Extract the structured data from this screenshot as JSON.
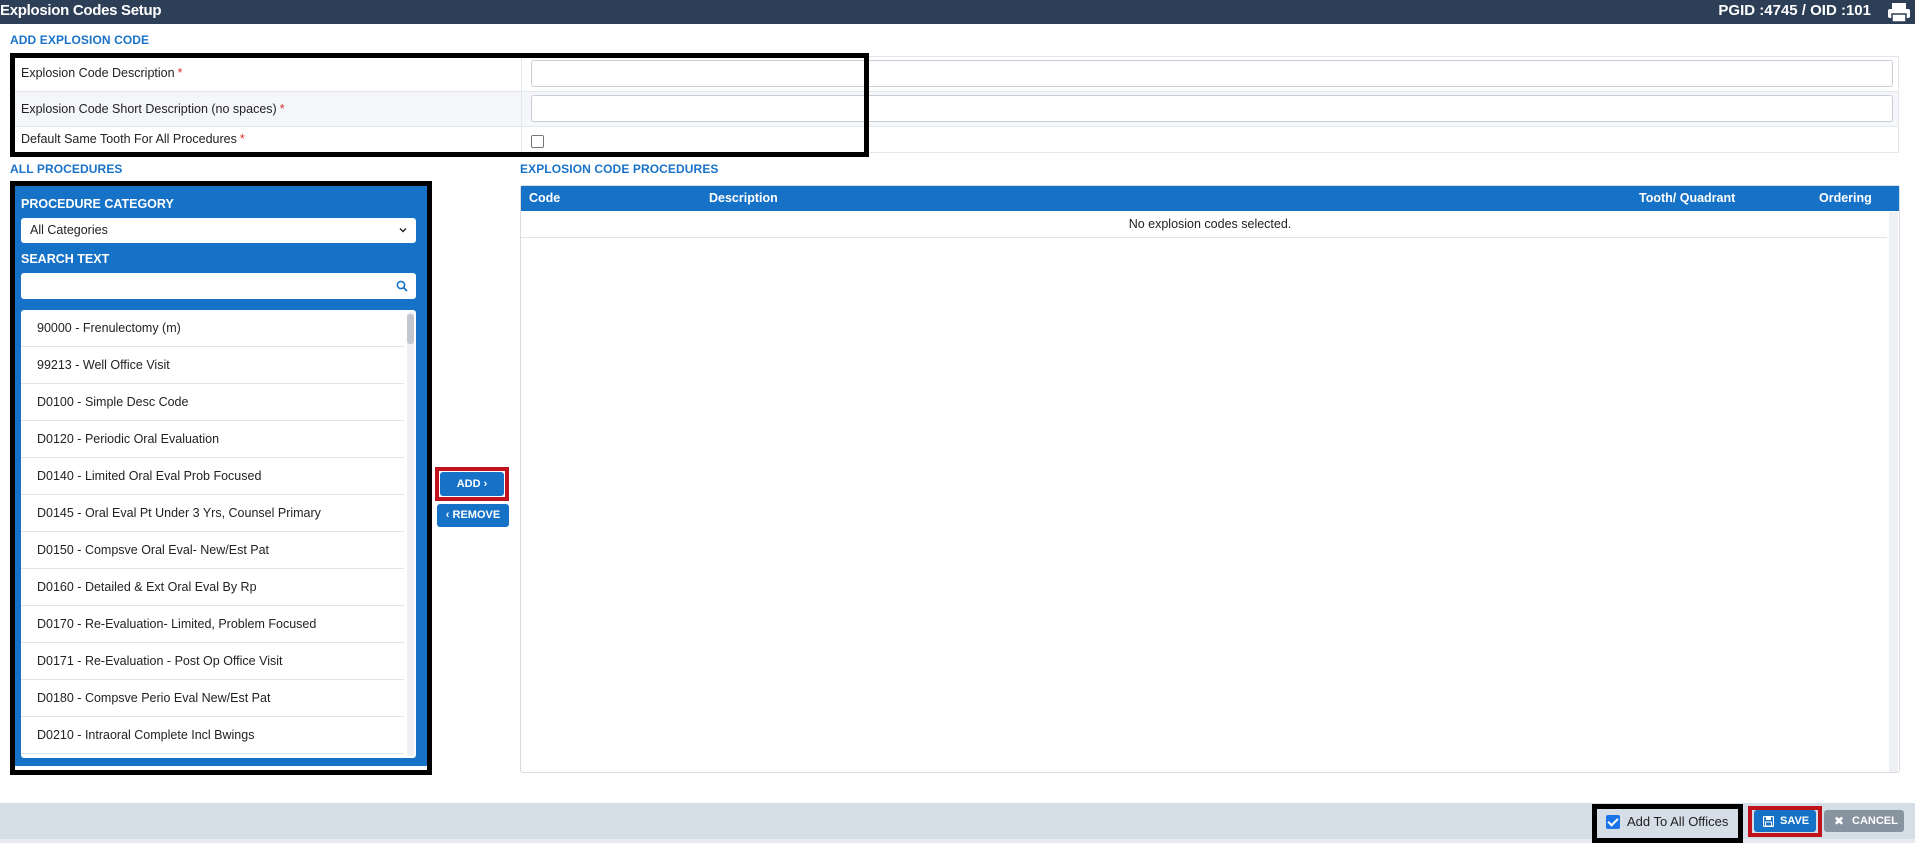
{
  "header": {
    "title": "Explosion Codes Setup",
    "ids": "PGID :4745  /  OID :101",
    "print_icon": "printer-icon"
  },
  "add_section": {
    "label": "ADD EXPLOSION CODE",
    "fields": [
      {
        "label": "Explosion Code Description",
        "required": "*",
        "value": ""
      },
      {
        "label": "Explosion Code Short Description (no spaces)",
        "required": "*",
        "value": ""
      },
      {
        "label": "Default Same Tooth For All Procedures",
        "required": "*",
        "checked": false
      }
    ]
  },
  "all_procedures": {
    "label": "ALL PROCEDURES",
    "category_heading": "PROCEDURE CATEGORY",
    "category_selected": "All Categories",
    "search_heading": "SEARCH TEXT",
    "search_value": "",
    "items": [
      "90000 - Frenulectomy (m)",
      "99213 - Well Office Visit",
      "D0100 - Simple Desc Code",
      "D0120 - Periodic Oral Evaluation",
      "D0140 - Limited Oral Eval Prob Focused",
      "D0145 - Oral Eval Pt Under 3 Yrs, Counsel Primary",
      "D0150 - Compsve Oral Eval- New/Est Pat",
      "D0160 - Detailed & Ext Oral Eval By Rp",
      "D0170 - Re-Evaluation- Limited, Problem Focused",
      "D0171 - Re-Evaluation - Post Op Office Visit",
      "D0180 - Compsve Perio Eval New/Est Pat",
      "D0210 - Intraoral Complete Incl Bwings"
    ]
  },
  "transfer": {
    "add_label": "ADD",
    "add_icon": "chevron-right-icon",
    "remove_label": "REMOVE",
    "remove_icon": "chevron-left-icon"
  },
  "explosion_procedures": {
    "label": "EXPLOSION CODE PROCEDURES",
    "columns": [
      "Code",
      "Description",
      "Tooth/ Quadrant",
      "Ordering"
    ],
    "empty_message": "No explosion codes selected."
  },
  "footer": {
    "add_all_offices_label": "Add To All Offices",
    "add_all_offices_checked": true,
    "save_label": "SAVE",
    "save_icon": "floppy-disk-icon",
    "cancel_label": "CANCEL",
    "cancel_icon": "close-icon"
  },
  "colors": {
    "header_bg": "#2d3e57",
    "accent": "#1672c6",
    "required": "#d9302c",
    "highlight_red": "#c0121b"
  }
}
